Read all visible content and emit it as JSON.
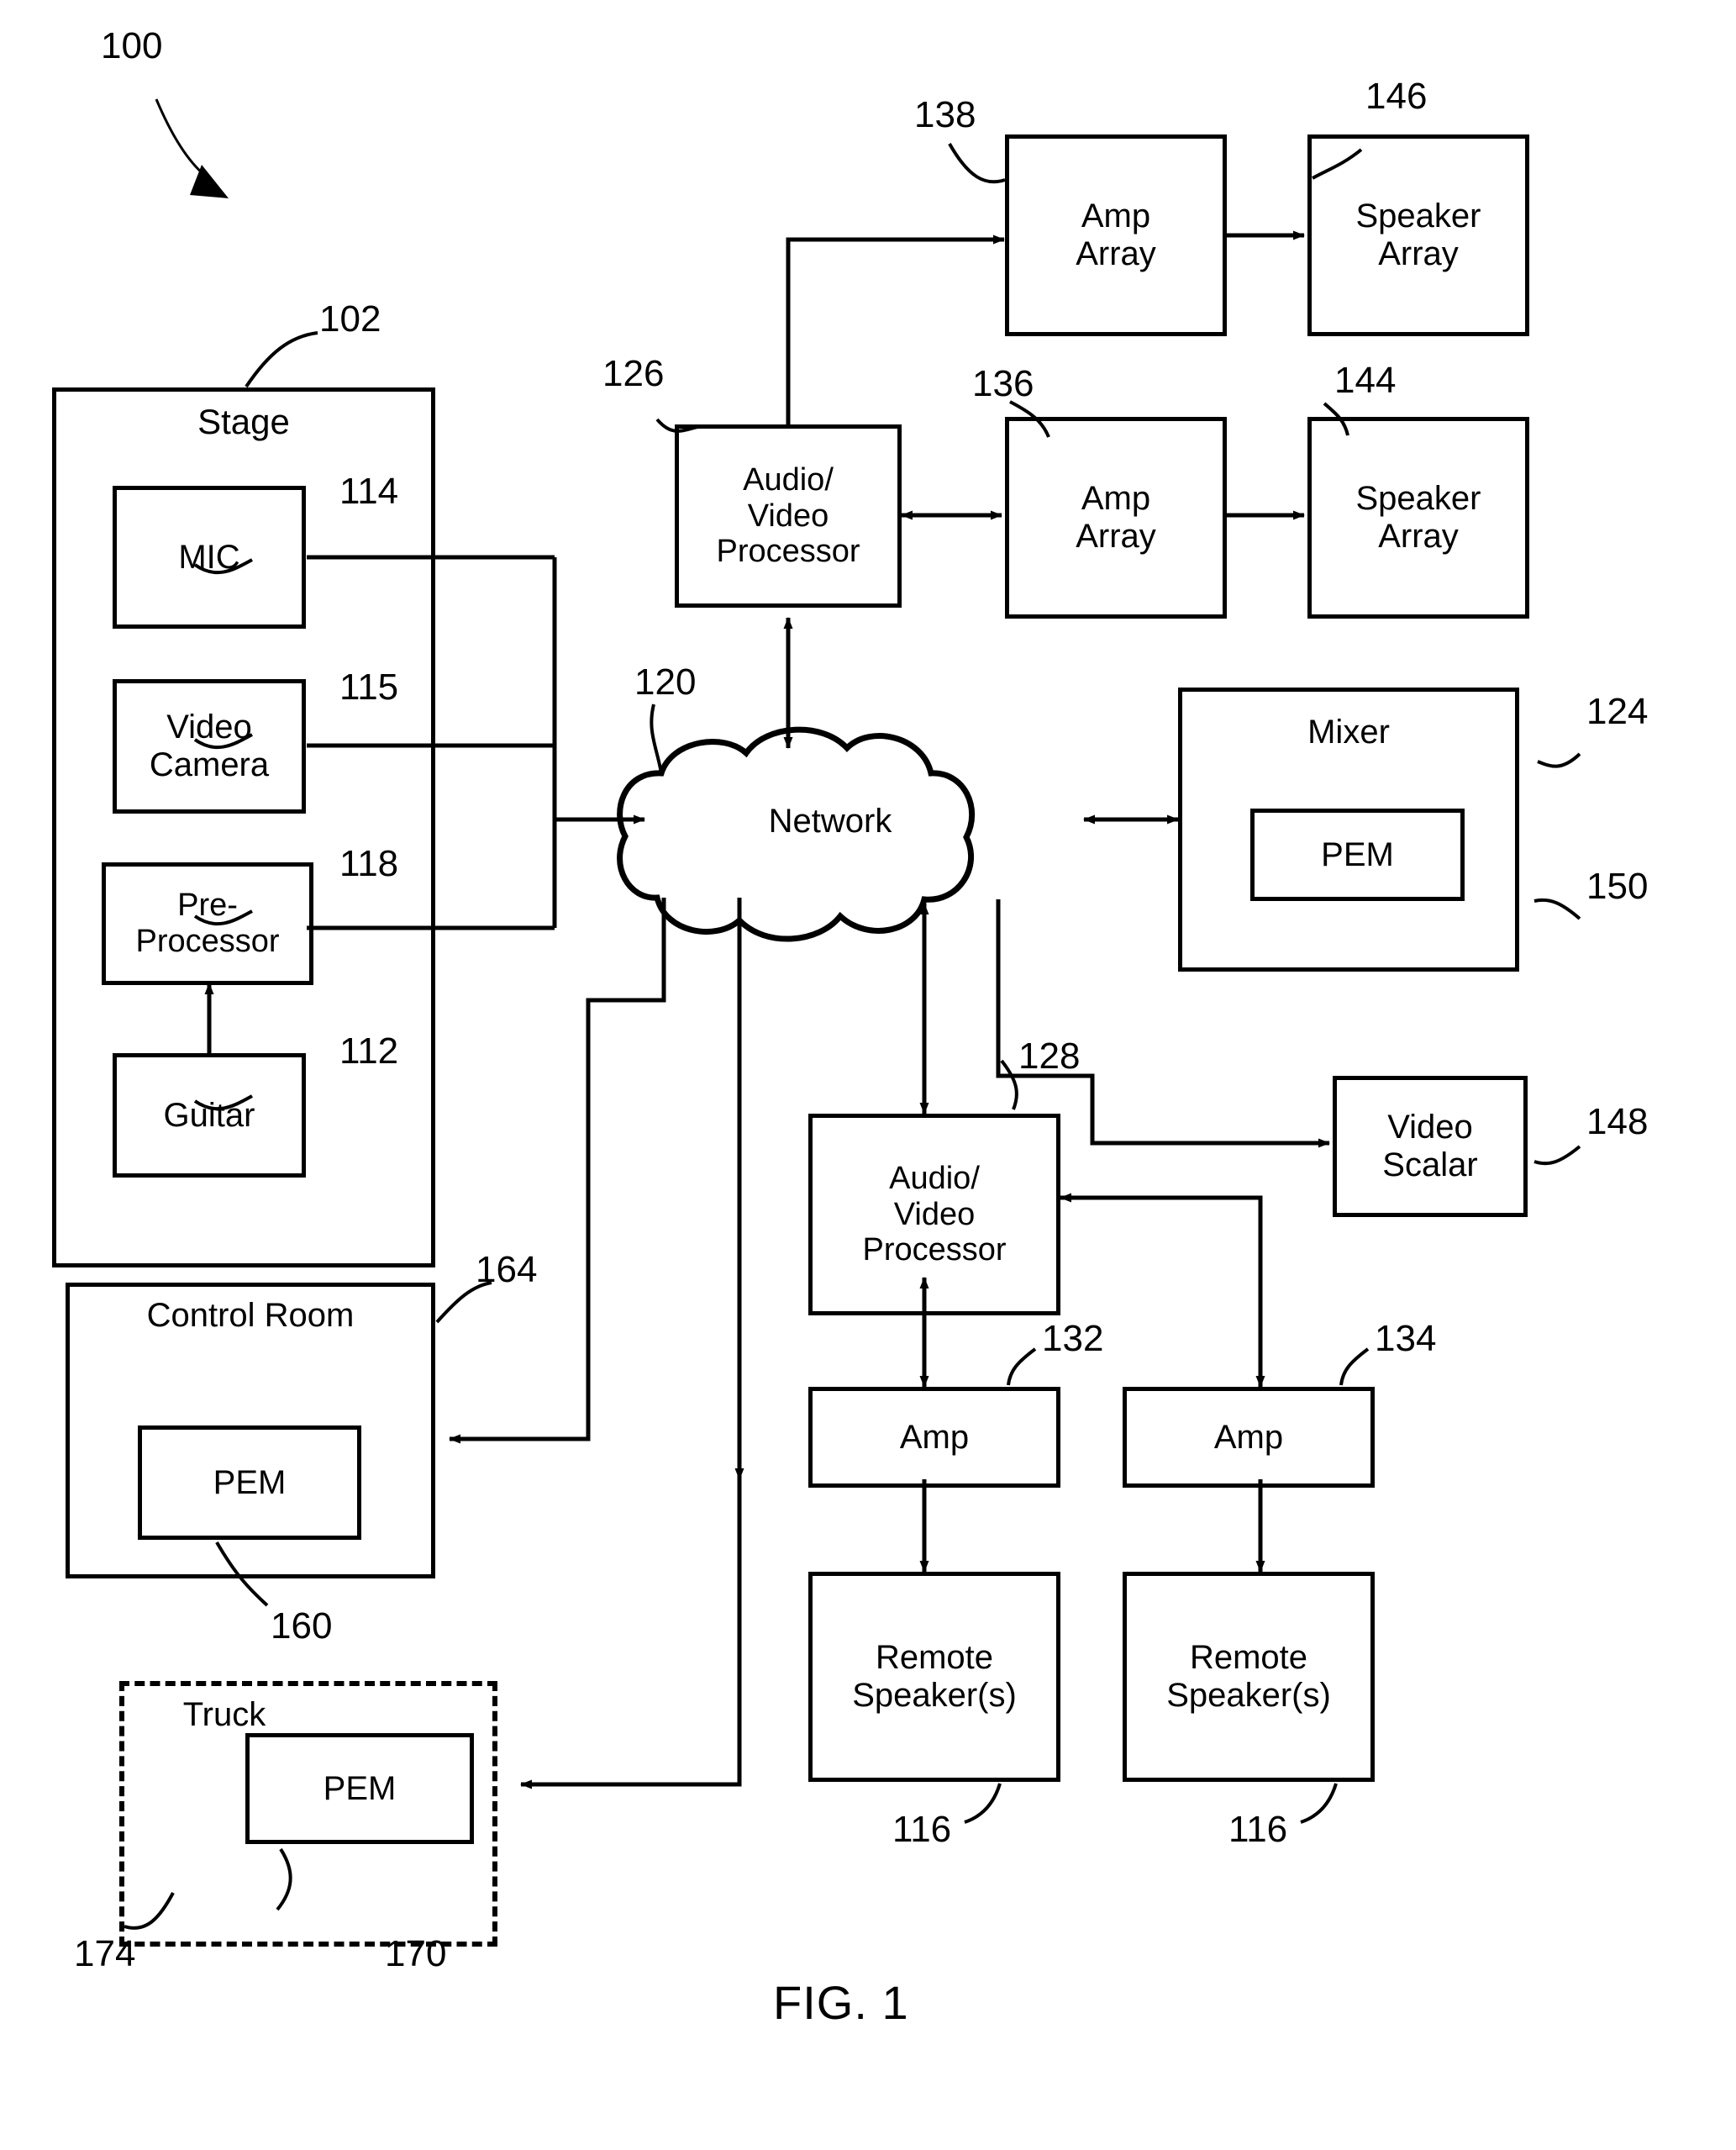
{
  "figure": {
    "caption": "FIG. 1",
    "system_ref": "100"
  },
  "nodes": [
    {
      "id": "stage",
      "label": "Stage",
      "ref": "102",
      "shape": "rect-container"
    },
    {
      "id": "mic",
      "label": "MIC",
      "ref": "114",
      "shape": "rect"
    },
    {
      "id": "video-camera",
      "label": "Video\nCamera",
      "ref": "115",
      "shape": "rect"
    },
    {
      "id": "pre-processor",
      "label": "Pre-\nProcessor",
      "ref": "118",
      "shape": "rect"
    },
    {
      "id": "guitar",
      "label": "Guitar",
      "ref": "112",
      "shape": "rect"
    },
    {
      "id": "control-room",
      "label": "Control Room",
      "ref": "164",
      "shape": "rect-container"
    },
    {
      "id": "control-room-pem",
      "label": "PEM",
      "ref": "160",
      "shape": "rect"
    },
    {
      "id": "truck",
      "label": "Truck",
      "ref": "174",
      "shape": "dashed-container"
    },
    {
      "id": "truck-pem",
      "label": "PEM",
      "ref": "170",
      "shape": "rect"
    },
    {
      "id": "network",
      "label": "Network",
      "ref": "120",
      "shape": "cloud"
    },
    {
      "id": "avp-top",
      "label": "Audio/\nVideo\nProcessor",
      "ref": "126",
      "shape": "rect"
    },
    {
      "id": "amp-array-138",
      "label": "Amp\nArray",
      "ref": "138",
      "shape": "rect"
    },
    {
      "id": "speaker-array-146",
      "label": "Speaker\nArray",
      "ref": "146",
      "shape": "rect"
    },
    {
      "id": "amp-array-136",
      "label": "Amp\nArray",
      "ref": "136",
      "shape": "rect"
    },
    {
      "id": "speaker-array-144",
      "label": "Speaker\nArray",
      "ref": "144",
      "shape": "rect"
    },
    {
      "id": "mixer",
      "label": "Mixer",
      "ref": "124",
      "shape": "rect-container"
    },
    {
      "id": "mixer-pem",
      "label": "PEM",
      "ref": "150",
      "shape": "rect"
    },
    {
      "id": "avp-bottom",
      "label": "Audio/\nVideo\nProcessor",
      "ref": "128",
      "shape": "rect"
    },
    {
      "id": "video-scalar",
      "label": "Video\nScalar",
      "ref": "148",
      "shape": "rect"
    },
    {
      "id": "amp-132",
      "label": "Amp",
      "ref": "132",
      "shape": "rect"
    },
    {
      "id": "amp-134",
      "label": "Amp",
      "ref": "134",
      "shape": "rect"
    },
    {
      "id": "remote-speakers-left",
      "label": "Remote\nSpeaker(s)",
      "ref": "116",
      "shape": "rect"
    },
    {
      "id": "remote-speakers-right",
      "label": "Remote\nSpeaker(s)",
      "ref": "116",
      "shape": "rect"
    }
  ],
  "labels": {
    "stage": "Stage",
    "mic": "MIC",
    "video_camera": "Video\nCamera",
    "pre_processor": "Pre-\nProcessor",
    "guitar": "Guitar",
    "control_room": "Control Room",
    "control_room_pem": "PEM",
    "truck": "Truck",
    "truck_pem": "PEM",
    "network": "Network",
    "avp_top": "Audio/\nVideo\nProcessor",
    "amp_array_138": "Amp\nArray",
    "speaker_array_146": "Speaker\nArray",
    "amp_array_136": "Amp\nArray",
    "speaker_array_144": "Speaker\nArray",
    "mixer": "Mixer",
    "mixer_pem": "PEM",
    "avp_bottom": "Audio/\nVideo\nProcessor",
    "video_scalar": "Video\nScalar",
    "amp_132": "Amp",
    "amp_134": "Amp",
    "remote_speakers_left": "Remote\nSpeaker(s)",
    "remote_speakers_right": "Remote\nSpeaker(s)",
    "fig_caption": "FIG. 1"
  },
  "refs": {
    "system": "100",
    "stage": "102",
    "guitar": "112",
    "mic": "114",
    "video_camera": "115",
    "remote_speakers_left": "116",
    "remote_speakers_right": "116",
    "pre_processor": "118",
    "network": "120",
    "mixer": "124",
    "avp_top": "126",
    "avp_bottom": "128",
    "amp_132": "132",
    "amp_134": "134",
    "amp_array_136": "136",
    "amp_array_138": "138",
    "speaker_array_144": "144",
    "speaker_array_146": "146",
    "video_scalar": "148",
    "mixer_pem": "150",
    "control_room_pem": "160",
    "control_room": "164",
    "truck_pem": "170",
    "truck": "174"
  },
  "style": {
    "stroke": "#000000",
    "background": "#ffffff"
  }
}
